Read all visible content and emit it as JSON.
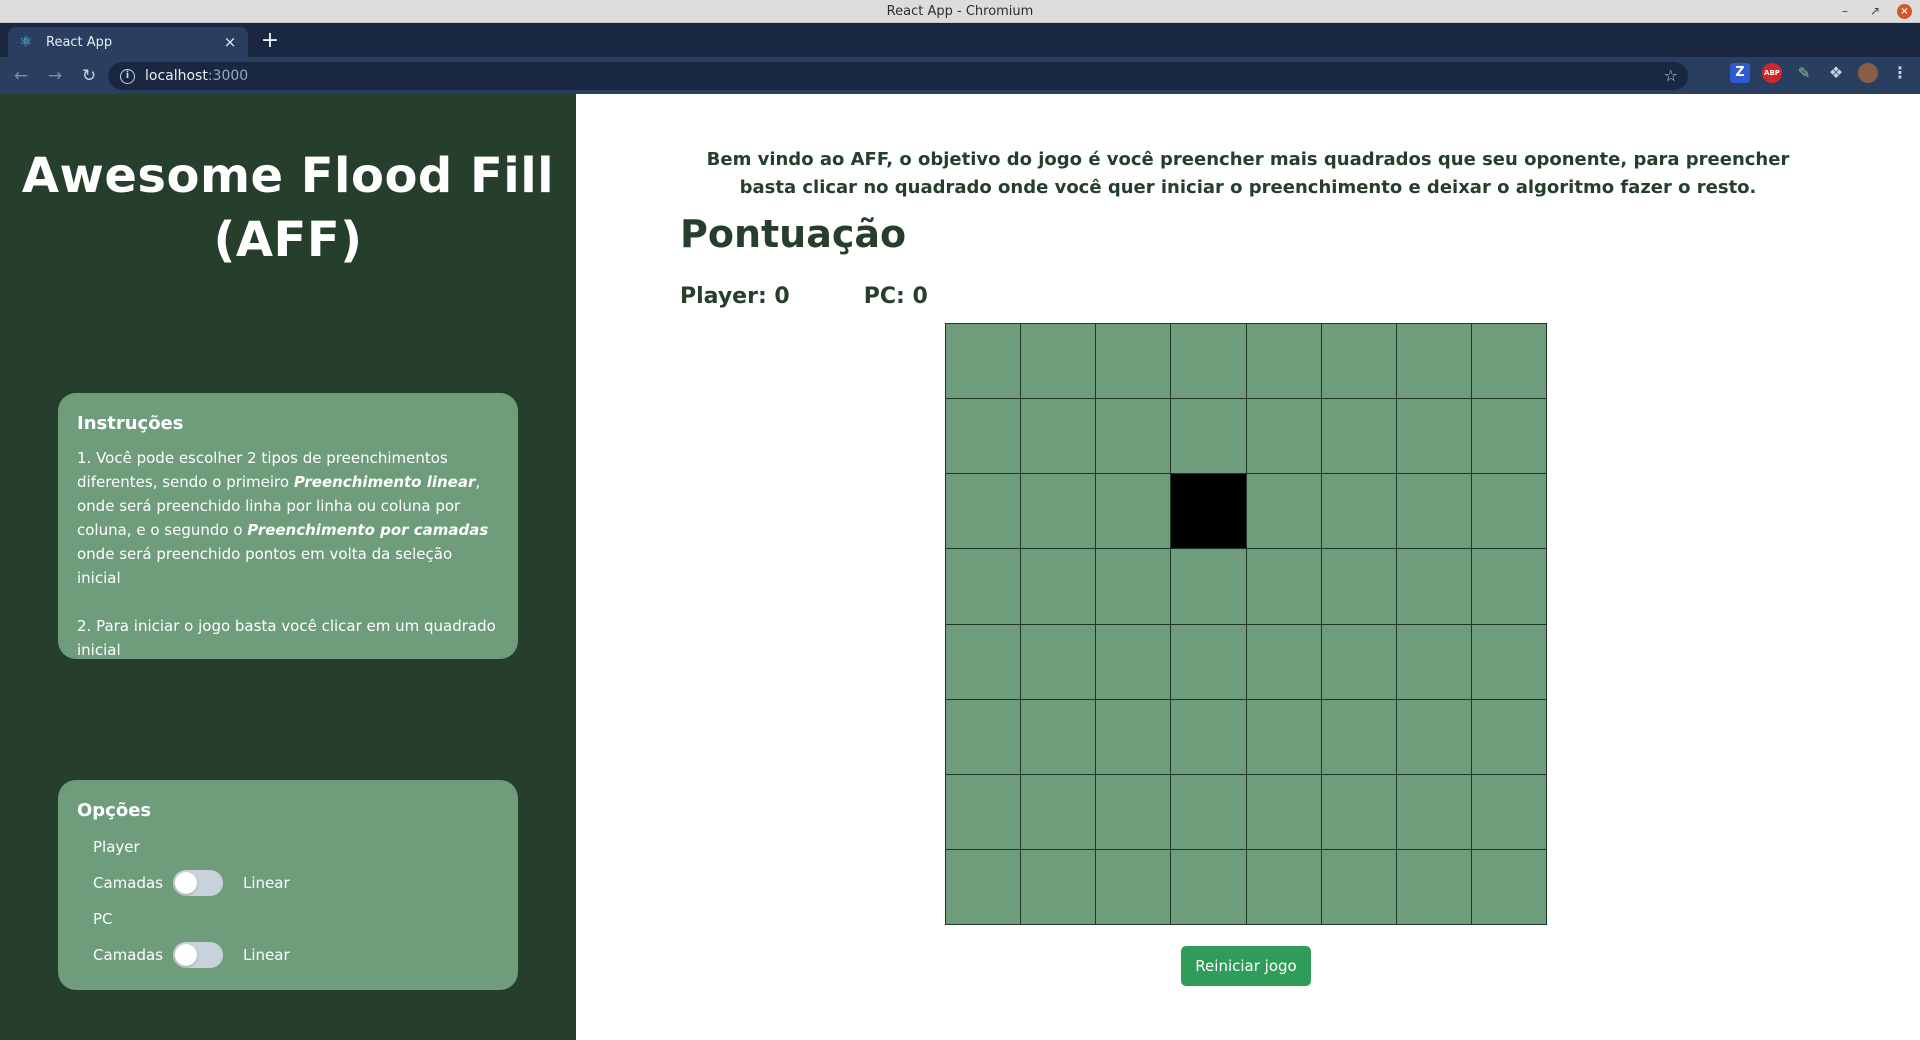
{
  "window": {
    "title": "React App - Chromium"
  },
  "browser": {
    "tab_title": "React App",
    "url_host": "localhost",
    "url_port": ":3000",
    "extensions": {
      "z_label": "Z",
      "abp_label": "ABP"
    }
  },
  "sidebar": {
    "title": "Awesome Flood Fill (AFF)",
    "instructions": {
      "heading": "Instruções",
      "p1_a": "1. Você pode escolher 2 tipos de preenchimentos diferentes, sendo o primeiro ",
      "p1_b": "Preenchimento linear",
      "p1_c": ", onde será preenchido linha por linha ou coluna por coluna, e o segundo o ",
      "p1_d": "Preenchimento por camadas",
      "p1_e": " onde será preenchido pontos em volta da seleção inicial",
      "p2": "2. Para iniciar o jogo basta você clicar em um quadrado inicial"
    },
    "options": {
      "heading": "Opções",
      "player_label": "Player",
      "pc_label": "PC",
      "left_label": "Camadas",
      "right_label": "Linear",
      "player_mode": "Camadas",
      "pc_mode": "Camadas"
    }
  },
  "main": {
    "welcome": "Bem vindo ao AFF, o objetivo do jogo é você preencher mais quadrados que seu oponente, para preencher basta clicar no quadrado onde você quer iniciar o preenchimento e deixar o algoritmo fazer o resto.",
    "score_title": "Pontuação",
    "player_score": "Player: 0",
    "pc_score": "PC: 0",
    "restart_label": "Reiniciar jogo",
    "board": {
      "rows": 8,
      "cols": 8,
      "filled_cells": [
        {
          "row": 2,
          "col": 3
        }
      ],
      "empty_color": "#6f9c7b",
      "filled_color": "#000000"
    }
  },
  "colors": {
    "sidebar_bg": "#253f2c",
    "card_bg": "#6f9c7b",
    "accent_green": "#2f9c5a",
    "text_dark": "#253f2c"
  }
}
